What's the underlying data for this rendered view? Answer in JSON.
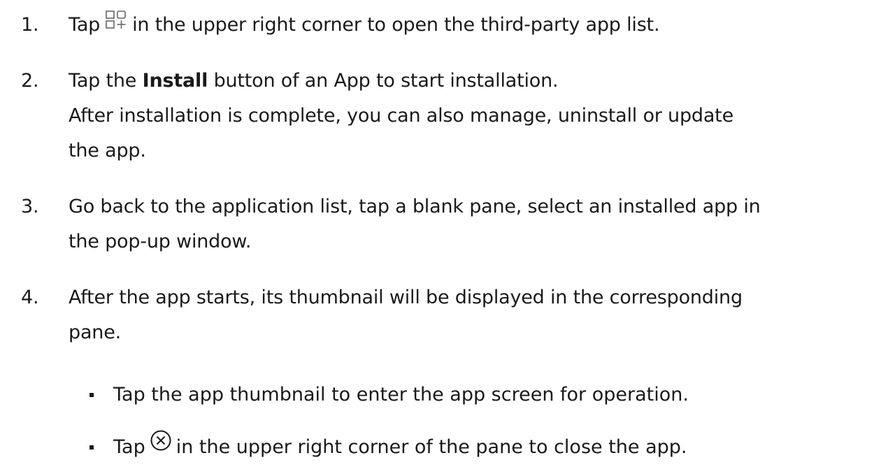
{
  "steps": [
    {
      "number": "1.",
      "before_icon": "Tap",
      "icon": "grid-plus-icon",
      "after_icon": "in the upper right corner to open the third-party app list."
    },
    {
      "number": "2.",
      "prefix": "Tap the",
      "bold": "Install",
      "suffix": "button of an App to start installation.",
      "line2": "After installation is complete, you can also manage, uninstall or update",
      "line3": "the app."
    },
    {
      "number": "3.",
      "line1": "Go back to the application list, tap a blank pane, select an installed app in",
      "line2": "the pop-up window."
    },
    {
      "number": "4.",
      "line1": "After the app starts, its thumbnail will be displayed in the corresponding",
      "line2": "pane."
    }
  ],
  "bullets": [
    {
      "text": "Tap the app thumbnail to enter the app screen for operation."
    },
    {
      "before_icon": "Tap",
      "icon": "close-circle-icon",
      "after_icon": "in the upper right corner of the pane to close the app."
    }
  ]
}
